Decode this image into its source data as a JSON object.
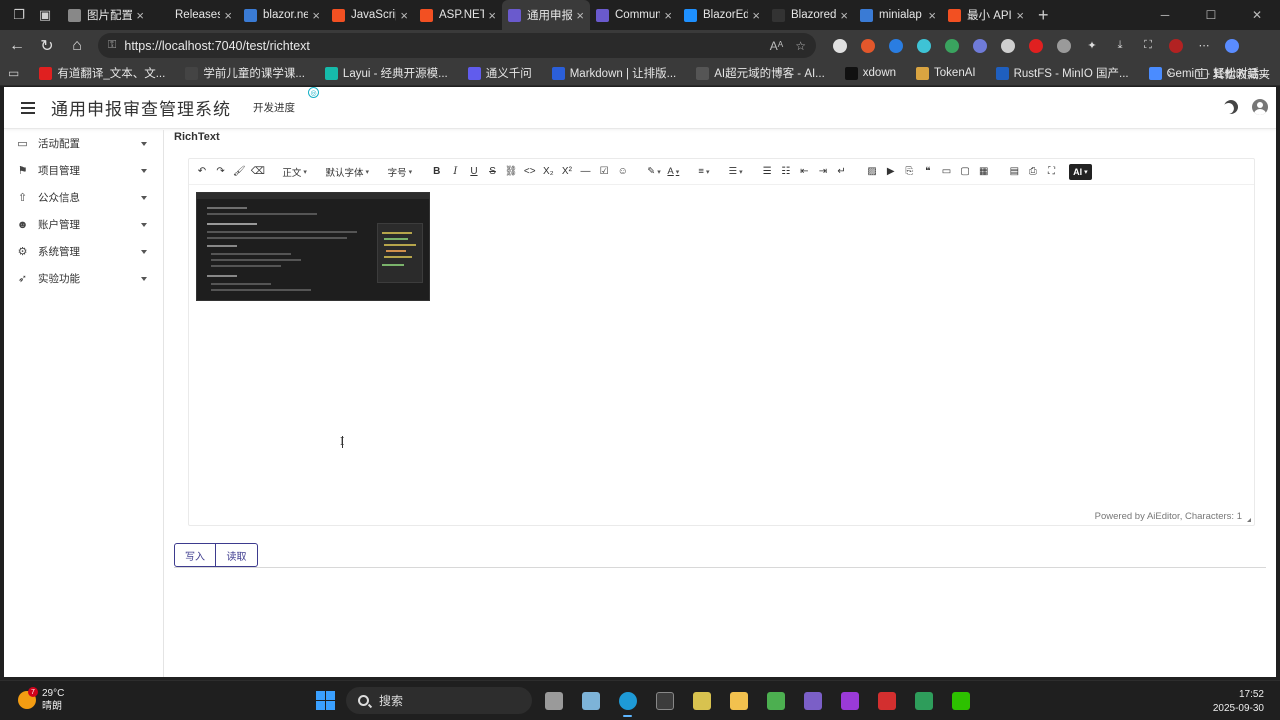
{
  "browser": {
    "tabs": [
      {
        "title": "图片配置",
        "fav": "#888888"
      },
      {
        "title": "Releases",
        "fav": ""
      },
      {
        "title": "blazor.ne",
        "fav": "#3a7bd5"
      },
      {
        "title": "JavaScrip",
        "fav": "#f25022"
      },
      {
        "title": "ASP.NET",
        "fav": "#f25022"
      },
      {
        "title": "通用申报",
        "fav": "#6a5acd",
        "active": true
      },
      {
        "title": "Commun",
        "fav": "#6a5acd"
      },
      {
        "title": "BlazorEdi",
        "fav": "#1e90ff"
      },
      {
        "title": "Blazored",
        "fav": "#333333"
      },
      {
        "title": "minialap",
        "fav": "#3a7bd5"
      },
      {
        "title": "最小 API",
        "fav": "#f25022"
      }
    ],
    "url": "https://localhost:7040/test/richtext",
    "bookmarks": [
      {
        "label": "有道翻译_文本、文...",
        "color": "#e02020"
      },
      {
        "label": "学前儿童的课学课...",
        "color": "#444444"
      },
      {
        "label": "Layui - 经典开源模...",
        "color": "#16baaa"
      },
      {
        "label": "通义千问",
        "color": "#615ced"
      },
      {
        "label": "Markdown | 让排版...",
        "color": "#2b5fd9"
      },
      {
        "label": "AI超元域的博客 - AI...",
        "color": "#555555"
      },
      {
        "label": "xdown",
        "color": "#111111"
      },
      {
        "label": "TokenAI",
        "color": "#d9a441"
      },
      {
        "label": "RustFS - MinIO 国产...",
        "color": "#1f5fbf"
      },
      {
        "label": "Gemini - 轻松对话...",
        "color": "#4a8cff"
      }
    ],
    "bookmarks_folder": "其他收藏夹"
  },
  "app": {
    "title": "通用申报审查管理系统",
    "dev_link": "开发进度",
    "sidebar": [
      {
        "label": "活动配置",
        "icon": "ticket-icon"
      },
      {
        "label": "项目管理",
        "icon": "flag-icon"
      },
      {
        "label": "公众信息",
        "icon": "upload-icon"
      },
      {
        "label": "账户管理",
        "icon": "user-gear-icon"
      },
      {
        "label": "系统管理",
        "icon": "gear-icon"
      },
      {
        "label": "实验功能",
        "icon": "rocket-icon"
      }
    ],
    "section_title": "RichText",
    "editor": {
      "toolbar": {
        "paragraph": "正文",
        "font": "默认字体",
        "size": "字号",
        "ai": "AI"
      },
      "footer": "Powered by AiEditor, Characters: 1"
    },
    "buttons": {
      "write": "写入",
      "read": "读取"
    }
  },
  "taskbar": {
    "temperature": "29°C",
    "weather": "晴朗",
    "weather_badge": "7",
    "search": "搜索",
    "time": "17:52",
    "date": "2025-09-30"
  }
}
